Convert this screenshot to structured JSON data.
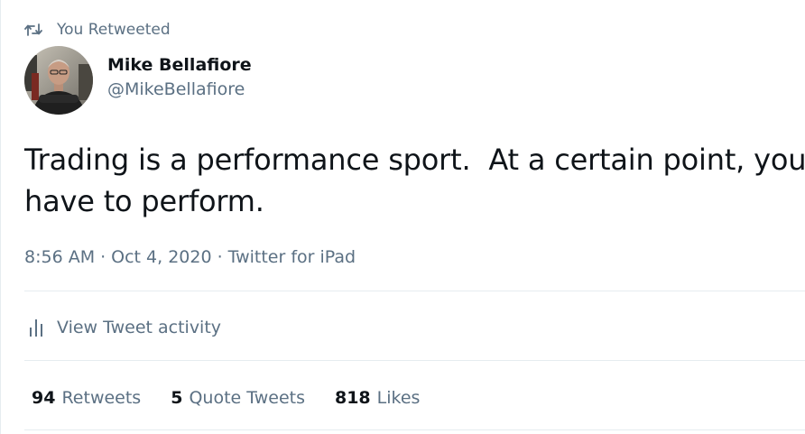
{
  "retweet_context": {
    "icon": "retweet-icon",
    "label": "You Retweeted"
  },
  "author": {
    "display_name": "Mike Bellafiore",
    "handle": "@MikeBellafiore",
    "avatar_icon": "avatar"
  },
  "tweet": {
    "text": "Trading is a performance sport.  At a certain point, you have to perform."
  },
  "meta": {
    "time": "8:56 AM",
    "separator1": "·",
    "date": "Oct 4, 2020",
    "separator2": "·",
    "source": "Twitter for iPad"
  },
  "activity": {
    "icon": "bar-chart-icon",
    "label": "View Tweet activity"
  },
  "stats": {
    "retweets": {
      "count": "94",
      "label": "Retweets"
    },
    "quote_tweets": {
      "count": "5",
      "label": "Quote Tweets"
    },
    "likes": {
      "count": "818",
      "label": "Likes"
    }
  },
  "colors": {
    "primary_text": "#0f1419",
    "secondary_text": "#5b7083",
    "divider": "#e6ecf0"
  }
}
